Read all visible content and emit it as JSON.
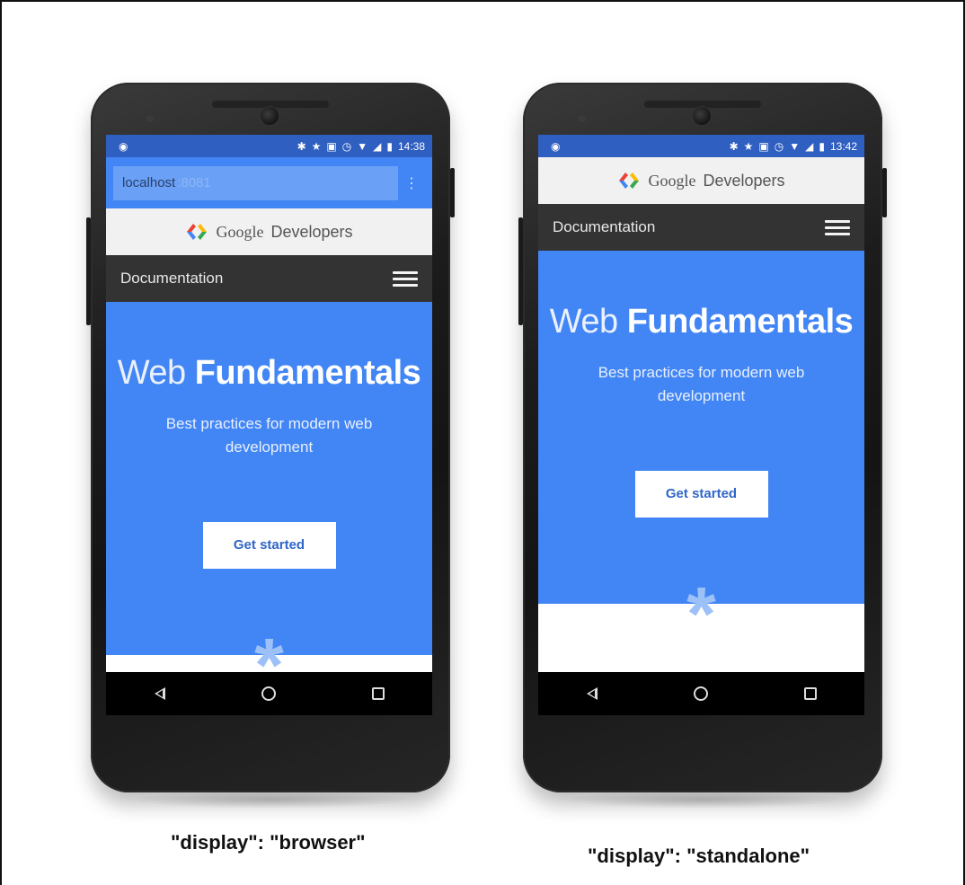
{
  "phones": [
    {
      "status_time": "14:38",
      "url_host": "localhost",
      "url_port": ":8081",
      "brand_google": "Google",
      "brand_developers": "Developers",
      "nav_label": "Documentation",
      "hero_title_light": "Web",
      "hero_title_bold": "Fundamentals",
      "hero_subtitle": "Best practices for modern web development",
      "cta_label": "Get started",
      "caption": "\"display\": \"browser\""
    },
    {
      "status_time": "13:42",
      "brand_google": "Google",
      "brand_developers": "Developers",
      "nav_label": "Documentation",
      "hero_title_light": "Web",
      "hero_title_bold": "Fundamentals",
      "hero_subtitle": "Best practices for modern web development",
      "cta_label": "Get started",
      "caption": "\"display\": \"standalone\""
    }
  ],
  "icons": {
    "status": [
      "android-debug-icon",
      "bluetooth-icon",
      "star-icon",
      "vibrate-icon",
      "alarm-icon",
      "wifi-icon",
      "signal-icon",
      "battery-icon"
    ],
    "nav": [
      "back-icon",
      "home-icon",
      "recents-icon"
    ],
    "asterisk": "*"
  },
  "colors": {
    "primary_blue": "#4285f4",
    "status_blue": "#2f5fc0",
    "doc_bar": "#333333",
    "brand_bar": "#f1f1f1"
  }
}
